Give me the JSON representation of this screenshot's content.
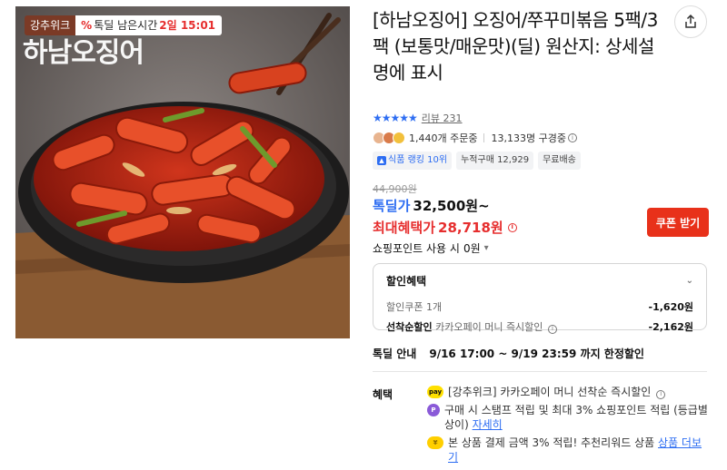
{
  "product_image": {
    "brand_text": "하남오징어",
    "badge_brand": "강추위크",
    "badge_pct": "%",
    "badge_timer_label": "톡딜 남은시간",
    "badge_timer_value": "2일 15:01"
  },
  "title": "[하남오징어] 오징어/쭈꾸미볶음 5팩/3팩 (보통맛/매운맛)(딜) 원산지: 상세설명에 표시",
  "rating": {
    "stars": "★★★★★",
    "review_label": "리뷰 231"
  },
  "social": {
    "orders": "1,440개 주문중",
    "subscribers": "13,133명 구경중"
  },
  "tags": [
    {
      "label": "식품 랭킹 10위",
      "icon": "rank-icon"
    },
    {
      "label": "누적구매 12,929"
    },
    {
      "label": "무료배송"
    }
  ],
  "price": {
    "original": "44,900원",
    "sale_label": "톡딜가",
    "sale_value": "32,500원~",
    "max_label": "최대혜택가",
    "max_value": "28,718원",
    "coupon_button": "쿠폰 받기",
    "points_label": "쇼핑포인트 사용 시",
    "points_value": "0원"
  },
  "benefits": {
    "heading": "할인혜택",
    "lines": [
      {
        "label": "할인쿠폰 1개",
        "value": "-1,620원"
      },
      {
        "label_bold": "선착순할인",
        "label": "카카오페이 머니 즉시할인",
        "value": "-2,162원"
      }
    ]
  },
  "deal_info": {
    "label": "톡딜 안내",
    "value": "9/16 17:00 ~ 9/19 23:59 까지 한정할인"
  },
  "benefit_list": {
    "label": "혜택",
    "items": [
      {
        "icon": "kakaopay-icon",
        "icon_text": "pay",
        "text": "[강추위크] 카카오페이 머니 선착순 즉시할인"
      },
      {
        "icon": "point-icon",
        "icon_text": "P",
        "text": "구매 시 스탬프 적립 및 최대 3% 쇼핑포인트 적립 (등급별 상이)",
        "link": "자세히"
      },
      {
        "icon": "coin-icon",
        "icon_text": "¥",
        "text": "본 상품 결제 금액 3% 적립! 추천리워드 상품",
        "link": "상품 더보기"
      }
    ]
  }
}
